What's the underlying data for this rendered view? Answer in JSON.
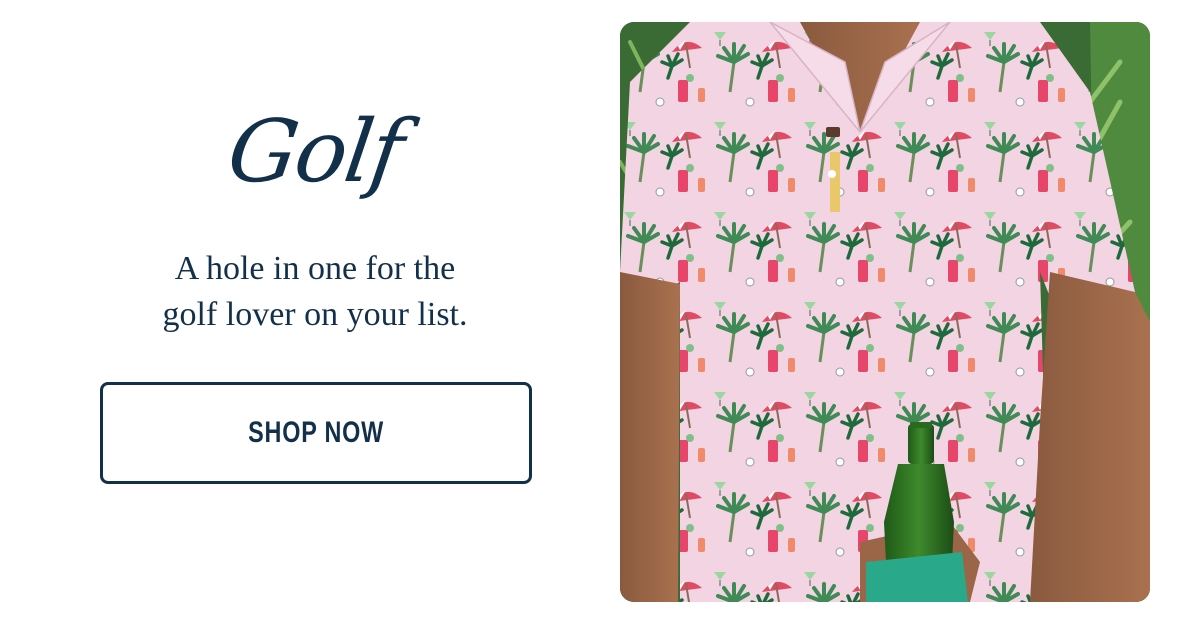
{
  "promo": {
    "title": "Golf",
    "tagline_line1": "A hole in one for the",
    "tagline_line2": "golf lover on your list.",
    "cta_label": "SHOP NOW"
  },
  "colors": {
    "navy": "#13304b",
    "background": "#ffffff",
    "shirt_pink": "#f2d4e2"
  },
  "photo": {
    "subject": "man in pink tropical print polo shirt holding green beer bottle with teal koozie"
  }
}
